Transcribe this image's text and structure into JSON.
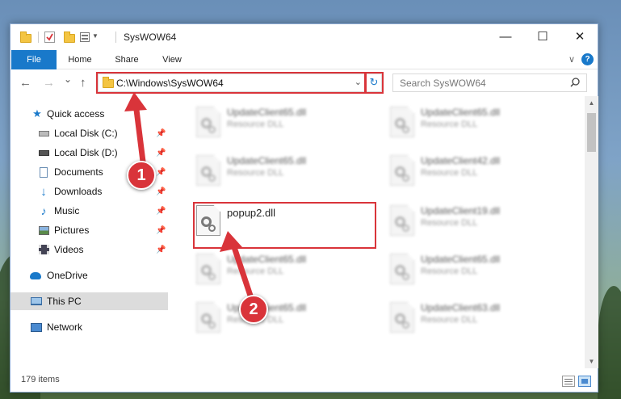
{
  "window": {
    "title": "SysWOW64",
    "minimize_glyph": "—",
    "maximize_glyph": "☐",
    "close_glyph": "✕"
  },
  "ribbon": {
    "tabs": [
      {
        "label": "File"
      },
      {
        "label": "Home"
      },
      {
        "label": "Share"
      },
      {
        "label": "View"
      }
    ],
    "collapse_glyph": "∨",
    "help_glyph": "?"
  },
  "nav": {
    "back_glyph": "←",
    "forward_glyph": "→",
    "recent_glyph": "⌄",
    "up_glyph": "↑",
    "address": "C:\\Windows\\SysWOW64",
    "address_dropdown_glyph": "⌄",
    "refresh_glyph": "↻",
    "search_placeholder": "Search SysWOW64"
  },
  "sidebar": {
    "items": [
      {
        "label": "Quick access",
        "icon": "star-icon",
        "pinned": false
      },
      {
        "label": "Local Disk (C:)",
        "icon": "drive-icon",
        "pinned": true
      },
      {
        "label": "Local Disk (D:)",
        "icon": "drive-icon",
        "pinned": true
      },
      {
        "label": "Documents",
        "icon": "documents-icon",
        "pinned": true
      },
      {
        "label": "Downloads",
        "icon": "download-arrow-icon",
        "pinned": true
      },
      {
        "label": "Music",
        "icon": "music-note-icon",
        "pinned": true
      },
      {
        "label": "Pictures",
        "icon": "pictures-icon",
        "pinned": true
      },
      {
        "label": "Videos",
        "icon": "film-icon",
        "pinned": true
      },
      {
        "label": "OneDrive",
        "icon": "cloud-icon",
        "pinned": false
      },
      {
        "label": "This PC",
        "icon": "monitor-icon",
        "pinned": false,
        "selected": true
      },
      {
        "label": "Network",
        "icon": "network-icon",
        "pinned": false
      }
    ],
    "pin_glyph": "📌"
  },
  "files": [
    {
      "name": "UpdateClient65.dll",
      "type": "Resource DLL",
      "blurred": true
    },
    {
      "name": "UpdateClient65.dll",
      "type": "Resource DLL",
      "blurred": true
    },
    {
      "name": "UpdateClient65.dll",
      "type": "Resource DLL",
      "blurred": true
    },
    {
      "name": "UpdateClient42.dll",
      "type": "Resource DLL",
      "blurred": true
    },
    {
      "name": "popup2.dll",
      "type": "",
      "blurred": false
    },
    {
      "name": "UpdateClient19.dll",
      "type": "Resource DLL",
      "blurred": true
    },
    {
      "name": "UpdateClient65.dll",
      "type": "Resource DLL",
      "blurred": true
    },
    {
      "name": "UpdateClient65.dll",
      "type": "Resource DLL",
      "blurred": true
    },
    {
      "name": "UpdateClient65.dll",
      "type": "Resource DLL",
      "blurred": true
    },
    {
      "name": "UpdateClient63.dll",
      "type": "Resource DLL",
      "blurred": true
    }
  ],
  "status": {
    "item_count": "179 items"
  },
  "annotations": {
    "step1": "1",
    "step2": "2",
    "color": "#d9343a"
  }
}
